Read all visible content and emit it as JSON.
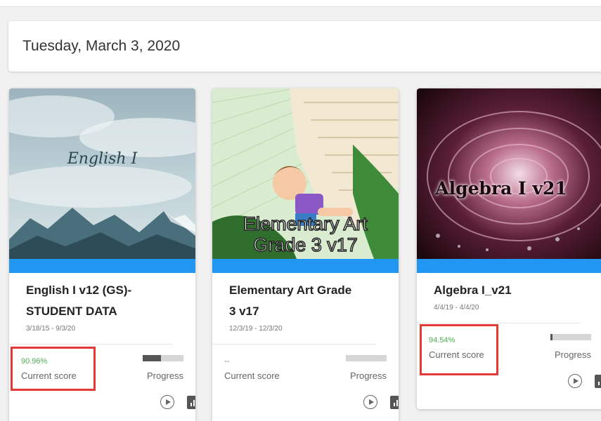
{
  "header": {
    "date": "Tuesday, March 3, 2020"
  },
  "cards": [
    {
      "cover_text": "English I",
      "title_lines": [
        "English I v12 (GS)-",
        "STUDENT DATA"
      ],
      "dates": "3/18/15 - 9/3/20",
      "score": "90.96%",
      "score_label": "Current score",
      "progress": 0.45,
      "progress_label": "Progress"
    },
    {
      "cover_text_lines": [
        "Elementary Art",
        "Grade 3 v17"
      ],
      "title_lines": [
        "Elementary Art Grade",
        "3 v17"
      ],
      "dates": "12/3/19 - 12/3/20",
      "score": "--",
      "score_label": "Current score",
      "progress": 0.0,
      "progress_label": "Progress"
    },
    {
      "cover_text": "Algebra I v21",
      "title_lines": [
        "Algebra I_v21"
      ],
      "dates": "4/4/19 - 4/4/20",
      "score": "94.54%",
      "score_label": "Current score",
      "progress": 0.05,
      "progress_label": "Progress"
    }
  ],
  "icons": {
    "play": "play-circle-icon",
    "report": "bar-chart-icon"
  },
  "colors": {
    "accent_strip": "#2196f3",
    "score_green": "#4caf50",
    "highlight_red": "#e53935"
  }
}
